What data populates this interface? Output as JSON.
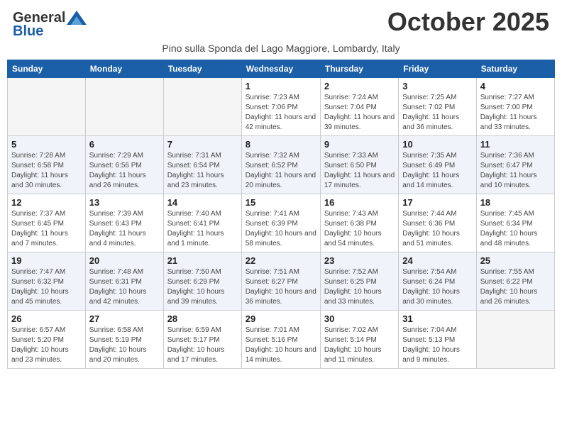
{
  "header": {
    "logo_general": "General",
    "logo_blue": "Blue",
    "month_title": "October 2025",
    "subtitle": "Pino sulla Sponda del Lago Maggiore, Lombardy, Italy"
  },
  "days_of_week": [
    "Sunday",
    "Monday",
    "Tuesday",
    "Wednesday",
    "Thursday",
    "Friday",
    "Saturday"
  ],
  "weeks": [
    [
      {
        "day": "",
        "info": ""
      },
      {
        "day": "",
        "info": ""
      },
      {
        "day": "",
        "info": ""
      },
      {
        "day": "1",
        "info": "Sunrise: 7:23 AM\nSunset: 7:06 PM\nDaylight: 11 hours and 42 minutes."
      },
      {
        "day": "2",
        "info": "Sunrise: 7:24 AM\nSunset: 7:04 PM\nDaylight: 11 hours and 39 minutes."
      },
      {
        "day": "3",
        "info": "Sunrise: 7:25 AM\nSunset: 7:02 PM\nDaylight: 11 hours and 36 minutes."
      },
      {
        "day": "4",
        "info": "Sunrise: 7:27 AM\nSunset: 7:00 PM\nDaylight: 11 hours and 33 minutes."
      }
    ],
    [
      {
        "day": "5",
        "info": "Sunrise: 7:28 AM\nSunset: 6:58 PM\nDaylight: 11 hours and 30 minutes."
      },
      {
        "day": "6",
        "info": "Sunrise: 7:29 AM\nSunset: 6:56 PM\nDaylight: 11 hours and 26 minutes."
      },
      {
        "day": "7",
        "info": "Sunrise: 7:31 AM\nSunset: 6:54 PM\nDaylight: 11 hours and 23 minutes."
      },
      {
        "day": "8",
        "info": "Sunrise: 7:32 AM\nSunset: 6:52 PM\nDaylight: 11 hours and 20 minutes."
      },
      {
        "day": "9",
        "info": "Sunrise: 7:33 AM\nSunset: 6:50 PM\nDaylight: 11 hours and 17 minutes."
      },
      {
        "day": "10",
        "info": "Sunrise: 7:35 AM\nSunset: 6:49 PM\nDaylight: 11 hours and 14 minutes."
      },
      {
        "day": "11",
        "info": "Sunrise: 7:36 AM\nSunset: 6:47 PM\nDaylight: 11 hours and 10 minutes."
      }
    ],
    [
      {
        "day": "12",
        "info": "Sunrise: 7:37 AM\nSunset: 6:45 PM\nDaylight: 11 hours and 7 minutes."
      },
      {
        "day": "13",
        "info": "Sunrise: 7:39 AM\nSunset: 6:43 PM\nDaylight: 11 hours and 4 minutes."
      },
      {
        "day": "14",
        "info": "Sunrise: 7:40 AM\nSunset: 6:41 PM\nDaylight: 11 hours and 1 minute."
      },
      {
        "day": "15",
        "info": "Sunrise: 7:41 AM\nSunset: 6:39 PM\nDaylight: 10 hours and 58 minutes."
      },
      {
        "day": "16",
        "info": "Sunrise: 7:43 AM\nSunset: 6:38 PM\nDaylight: 10 hours and 54 minutes."
      },
      {
        "day": "17",
        "info": "Sunrise: 7:44 AM\nSunset: 6:36 PM\nDaylight: 10 hours and 51 minutes."
      },
      {
        "day": "18",
        "info": "Sunrise: 7:45 AM\nSunset: 6:34 PM\nDaylight: 10 hours and 48 minutes."
      }
    ],
    [
      {
        "day": "19",
        "info": "Sunrise: 7:47 AM\nSunset: 6:32 PM\nDaylight: 10 hours and 45 minutes."
      },
      {
        "day": "20",
        "info": "Sunrise: 7:48 AM\nSunset: 6:31 PM\nDaylight: 10 hours and 42 minutes."
      },
      {
        "day": "21",
        "info": "Sunrise: 7:50 AM\nSunset: 6:29 PM\nDaylight: 10 hours and 39 minutes."
      },
      {
        "day": "22",
        "info": "Sunrise: 7:51 AM\nSunset: 6:27 PM\nDaylight: 10 hours and 36 minutes."
      },
      {
        "day": "23",
        "info": "Sunrise: 7:52 AM\nSunset: 6:25 PM\nDaylight: 10 hours and 33 minutes."
      },
      {
        "day": "24",
        "info": "Sunrise: 7:54 AM\nSunset: 6:24 PM\nDaylight: 10 hours and 30 minutes."
      },
      {
        "day": "25",
        "info": "Sunrise: 7:55 AM\nSunset: 6:22 PM\nDaylight: 10 hours and 26 minutes."
      }
    ],
    [
      {
        "day": "26",
        "info": "Sunrise: 6:57 AM\nSunset: 5:20 PM\nDaylight: 10 hours and 23 minutes."
      },
      {
        "day": "27",
        "info": "Sunrise: 6:58 AM\nSunset: 5:19 PM\nDaylight: 10 hours and 20 minutes."
      },
      {
        "day": "28",
        "info": "Sunrise: 6:59 AM\nSunset: 5:17 PM\nDaylight: 10 hours and 17 minutes."
      },
      {
        "day": "29",
        "info": "Sunrise: 7:01 AM\nSunset: 5:16 PM\nDaylight: 10 hours and 14 minutes."
      },
      {
        "day": "30",
        "info": "Sunrise: 7:02 AM\nSunset: 5:14 PM\nDaylight: 10 hours and 11 minutes."
      },
      {
        "day": "31",
        "info": "Sunrise: 7:04 AM\nSunset: 5:13 PM\nDaylight: 10 hours and 9 minutes."
      },
      {
        "day": "",
        "info": ""
      }
    ]
  ]
}
